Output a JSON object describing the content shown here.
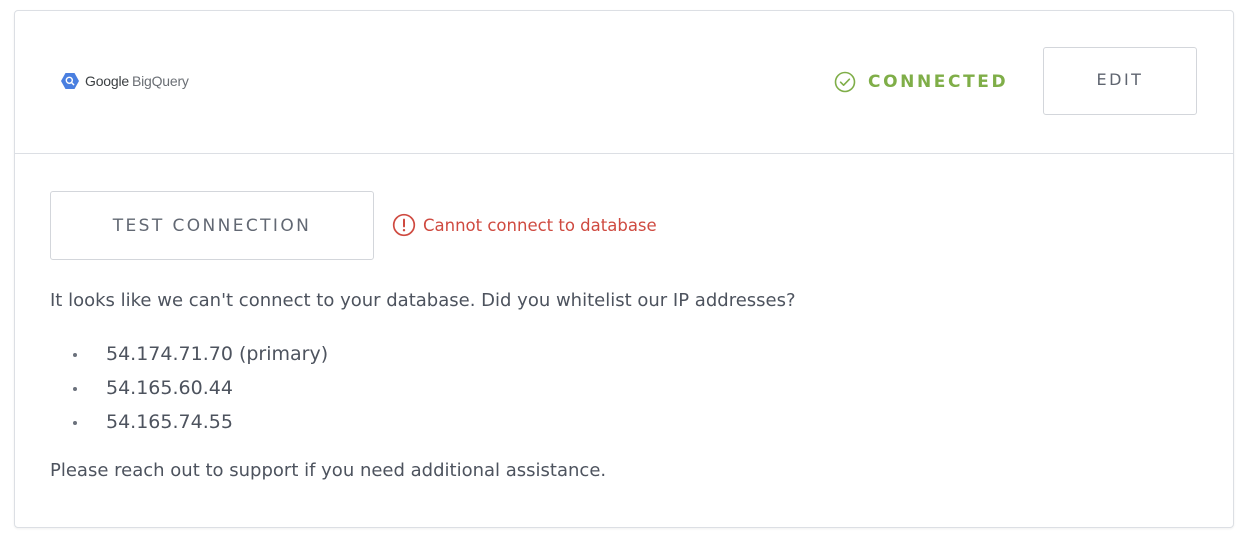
{
  "header": {
    "logo_google": "Google",
    "logo_product": "BigQuery",
    "logo_icon": "bigquery-logo-icon",
    "status_label": "CONNECTED",
    "status_icon": "check-circle-icon",
    "edit_label": "EDIT"
  },
  "test": {
    "button_label": "TEST CONNECTION",
    "error_icon": "alert-circle-icon",
    "error_text": "Cannot connect to database"
  },
  "body": {
    "message": "It looks like we can't connect to your database. Did you whitelist our IP addresses?",
    "ips": [
      "54.174.71.70 (primary)",
      "54.165.60.44",
      "54.165.74.55"
    ],
    "support": "Please reach out to support if you need additional assistance."
  },
  "colors": {
    "connected": "#7fae48",
    "error": "#cf4a40",
    "logo_blue": "#4a7fe0",
    "border": "#dcdfe4"
  }
}
